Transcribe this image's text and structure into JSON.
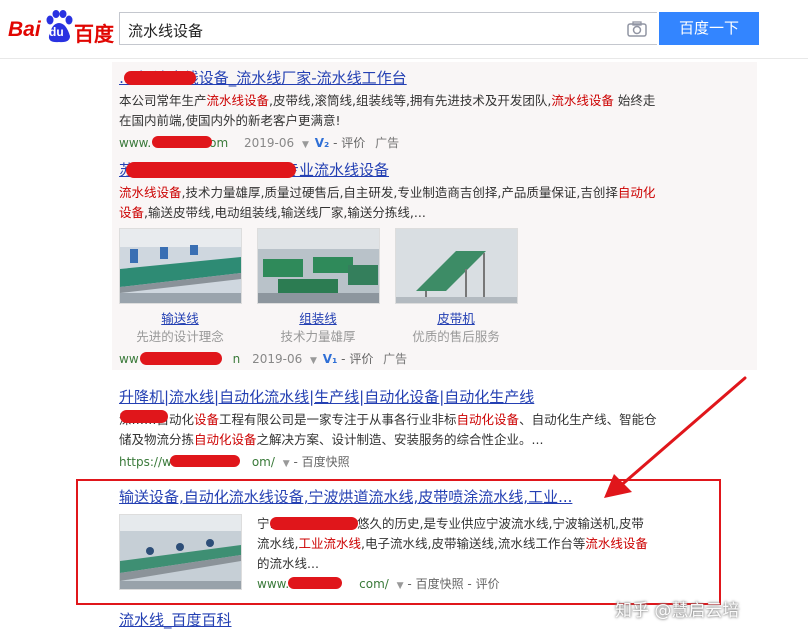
{
  "header": {
    "logo": {
      "text_left": "Bai",
      "text_mid": "du",
      "text_right": "百度"
    },
    "search_value": "流水线设备",
    "search_button": "百度一下"
  },
  "results": [
    {
      "title": "…家·流水线设备_流水线厂家-流水线工作台",
      "desc_parts": [
        "本公司常年生产",
        "流水线设备",
        ",皮带线,滚筒线,组装线等,拥有先进技术及开发团队,",
        "流水线设备",
        " 始终走在国内前端,使国内外的新老客户更满意!"
      ],
      "meta": {
        "url_start": "www.",
        "url_end": "om",
        "date": "2019-06",
        "badge": "V₂",
        "review": "评价",
        "ad": "广告"
      }
    },
    {
      "title": "苏州……有限公司是一家专业流水线设备",
      "desc_parts": [
        "流水线设备",
        ",技术力量雄厚,质量过硬售后,自主研发,专业制造商吉创择,产品质量保证,吉创择",
        "自动化设备",
        ",输送皮带线,电动组装线,输送线厂家,输送分拣线,..."
      ],
      "images": [
        {
          "label": "输送线",
          "sub": "先进的设计理念"
        },
        {
          "label": "组装线",
          "sub": "技术力量雄厚"
        },
        {
          "label": "皮带机",
          "sub": "优质的售后服务"
        }
      ],
      "meta": {
        "url_start": "ww",
        "url_end": "n",
        "date": "2019-06",
        "badge": "V₁",
        "review": "评价",
        "ad": "广告"
      }
    },
    {
      "title": "升降机|流水线|自动化流水线|生产线|自动化设备|自动化生产线",
      "desc_parts": [
        "深……自动化",
        "设备",
        "工程有限公司是一家专注于从事各行业非标",
        "自动化设备",
        "、自动化生产线、智能仓储及物流分拣",
        "自动化设备",
        "之解决方案、设计制造、安装服务的综合性企业。..."
      ],
      "meta": {
        "url_start": "https://w",
        "url_end": "om/",
        "snapshot": "百度快照"
      }
    },
    {
      "title": "输送设备,自动化流水线设备,宁波烘道流水线,皮带喷涂流水线,工业...",
      "desc_parts": [
        "宁……",
        "有限公司有悠久的历史,是专业供应宁波流水线,宁波输送机,皮带流水线,",
        "工业流水线",
        ",电子流水线,皮带输送线,流水线工作台等",
        "流水线设备",
        "的流水线..."
      ],
      "meta": {
        "url_start": "www.",
        "url_end": "com/",
        "snapshot": "百度快照",
        "review": "评价"
      }
    },
    {
      "title": "流水线_百度百科"
    }
  ],
  "watermark": "知乎 @慧启云培",
  "colors": {
    "accent": "#3385ff",
    "annotation": "#e0161b",
    "link": "#2440b3",
    "highlight": "#c00"
  }
}
